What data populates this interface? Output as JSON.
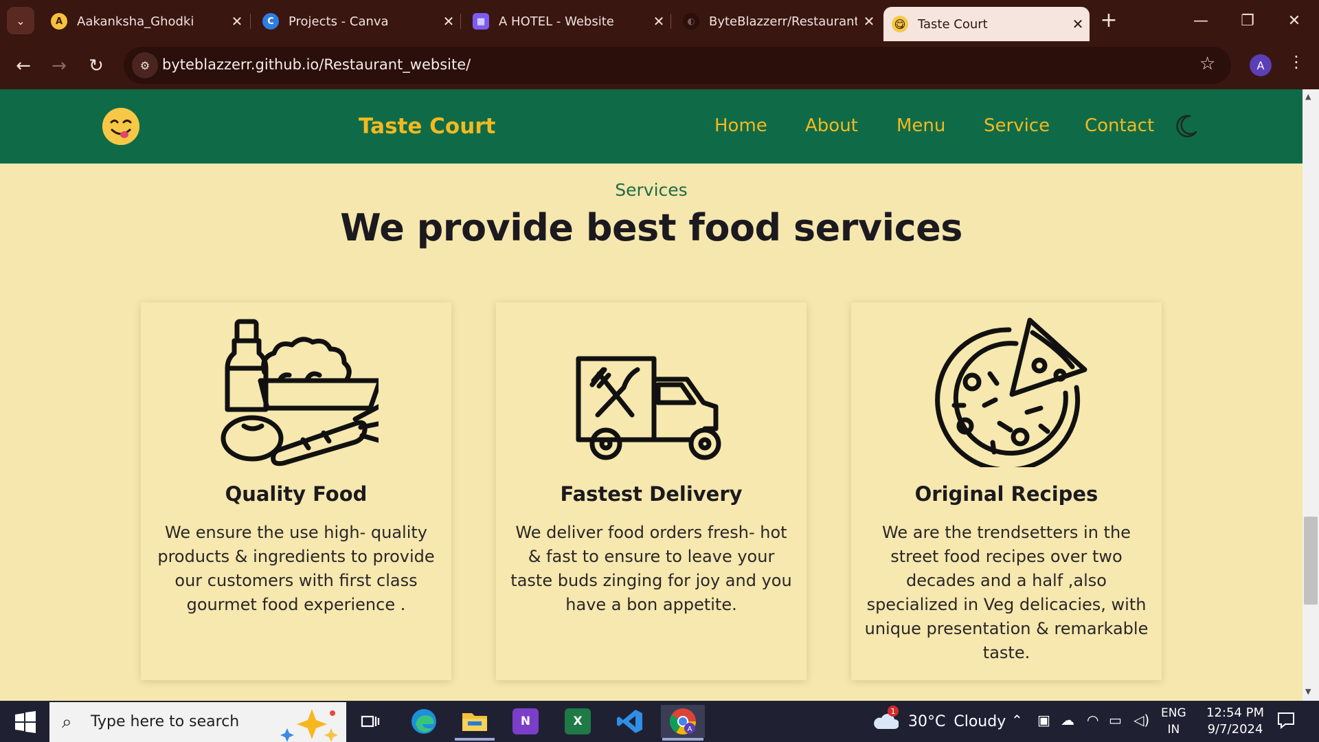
{
  "browser": {
    "tab_menu_icon": "chevron-down-icon",
    "tabs": [
      {
        "title": "Aakanksha_Ghodki",
        "favicon": "A",
        "favicon_color": "#f5c23a"
      },
      {
        "title": "Projects - Canva",
        "favicon": "C",
        "favicon_color": "#2e7de0"
      },
      {
        "title": "A HOTEL - Website",
        "favicon": "▦",
        "favicon_color": "#7a5cf0"
      },
      {
        "title": "ByteBlazzerr/Restaurant_v",
        "favicon": "◐",
        "favicon_color": "#3a1610"
      },
      {
        "title": "Taste Court",
        "favicon": "😋",
        "favicon_color": "#f7c845",
        "active": true
      }
    ],
    "tab_close_glyph": "✕",
    "new_tab_glyph": "+",
    "window_controls": {
      "minimize": "—",
      "restore": "❐",
      "close": "✕"
    },
    "nav": {
      "back": "←",
      "forward": "→",
      "reload": "↻"
    },
    "site_info_icon": "⚙",
    "url": "byteblazzerr.github.io/Restaurant_website/",
    "bookmark_glyph": "☆",
    "profile_initial": "A",
    "menu_glyph": "⋮"
  },
  "site": {
    "brand": "Taste Court",
    "nav": [
      "Home",
      "About",
      "Menu",
      "Service",
      "Contact"
    ],
    "colors": {
      "header_bg": "#0f6b47",
      "accent": "#f3b921",
      "page_bg": "#f5e7ae"
    }
  },
  "services": {
    "subtitle": "Services",
    "title": "We provide best food services",
    "cards": [
      {
        "icon": "groceries-icon",
        "title": "Quality Food",
        "text": "We ensure the use high- quality products & ingredients to provide our customers with first class gourmet food experience ."
      },
      {
        "icon": "delivery-truck-icon",
        "title": "Fastest Delivery",
        "text": "We deliver food orders fresh- hot & fast to ensure to leave your taste buds zinging for joy and you have a bon appetite."
      },
      {
        "icon": "pizza-icon",
        "title": "Original Recipes",
        "text": "We are the trendsetters in the street food recipes over two decades and a half ,also specialized in Veg delicacies, with unique presentation & remarkable taste."
      }
    ]
  },
  "taskbar": {
    "search_placeholder": "Type here to search",
    "apps": [
      "task-view",
      "edge",
      "file-explorer",
      "onenote",
      "excel",
      "vscode",
      "chrome"
    ],
    "weather": {
      "temp": "30°C",
      "condition": "Cloudy",
      "alert_count": "1"
    },
    "language": {
      "line1": "ENG",
      "line2": "IN"
    },
    "time": "12:54 PM",
    "date": "9/7/2024"
  }
}
